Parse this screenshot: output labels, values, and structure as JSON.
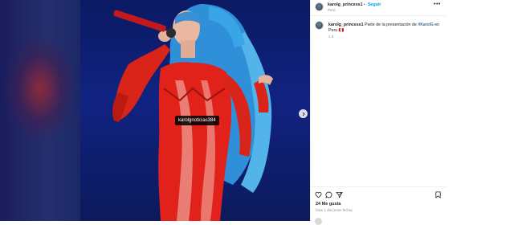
{
  "post": {
    "tag_label": "karolgnoticias384"
  },
  "header": {
    "username": "karolg_princess1",
    "separator": "•",
    "follow_label": "Seguir",
    "subtitle": "Perú",
    "more_icon": "more-horizontal-icon"
  },
  "caption": {
    "username": "karolg_princess1",
    "text_before": "Parte de la presentación de ",
    "hashtag": "#KarolG",
    "text_after": " en Peru 🇵🇪",
    "time": "1 d"
  },
  "actions": {
    "like_icon": "heart-icon",
    "comment_icon": "comment-icon",
    "share_icon": "send-icon",
    "save_icon": "bookmark-icon"
  },
  "likes": "24 Me gusta",
  "date": "hace 1 día (entre fecha)",
  "colors": {
    "follow": "#0095f6",
    "text": "#262626",
    "muted": "#8e8e8e"
  }
}
